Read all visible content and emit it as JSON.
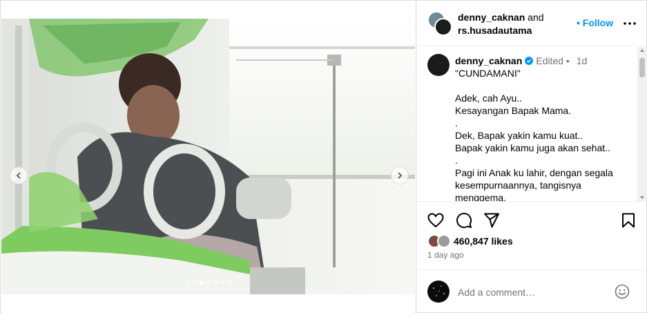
{
  "header": {
    "user_one": "denny_caknan",
    "joiner": "and",
    "user_two": "rs.husadautama",
    "follow_label": "• Follow"
  },
  "caption": {
    "username": "denny_caknan",
    "edited_label": "Edited •",
    "age": "1d",
    "lines": [
      "\"CUNDAMANI\"",
      "",
      "Adek, cah Ayu..",
      "Kesayangan Bapak Mama.",
      ".",
      "Dek, Bapak yakin kamu kuat..",
      "Bapak yakin kamu juga akan sehat..",
      ".",
      "Pagi ini Anak ku lahir, dengan segala",
      "kesempurnaannya, tangisnya",
      "menggema."
    ]
  },
  "likes": {
    "count_label": "460,847 likes"
  },
  "timestamp": "1 day ago",
  "comment": {
    "placeholder": "Add a comment…"
  },
  "carousel": {
    "slide_count": 7,
    "active_index": 2
  },
  "icons": {
    "like": "heart-icon",
    "comment": "comment-icon",
    "share": "paper-plane-icon",
    "save": "bookmark-icon",
    "more": "more-options-icon",
    "emoji": "emoji-icon",
    "verified": "verified-badge-icon"
  },
  "colors": {
    "follow": "#0095f6",
    "muted": "#737373",
    "divider": "#dbdbdb"
  }
}
